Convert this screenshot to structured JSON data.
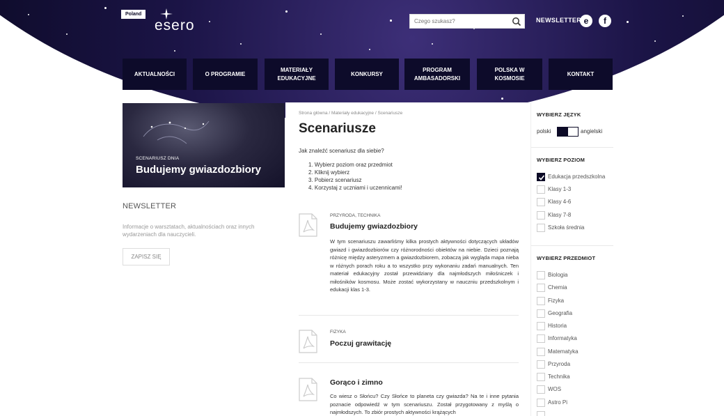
{
  "header": {
    "logo_country": "Poland",
    "logo_text": "esero",
    "search_placeholder": "Czego szukasz?",
    "newsletter_label": "NEWSLETTER",
    "e_label": "e",
    "fb_label": "f"
  },
  "nav": [
    "AKTUALNOŚCI",
    "O PROGRAMIE",
    "MATERIAŁY EDUKACYJNE",
    "KONKURSY",
    "PROGRAM AMBASADORSKI",
    "POLSKA W KOSMOSIE",
    "KONTAKT"
  ],
  "feature": {
    "label": "SCENARIUSZ DNIA",
    "title": "Budujemy gwiazdozbiory"
  },
  "newsletter": {
    "title": "NEWSLETTER",
    "text": "Informacje o warsztatach, aktualnościach oraz innych wydarzeniach dla nauczycieli.",
    "button": "ZAPISZ SIĘ"
  },
  "main": {
    "breadcrumb": "Strona główna  /  Materiały edukacyjne  /  Scenariusze",
    "title": "Scenariusze",
    "intro": "Jak znaleźć scenariusz dla siebie?",
    "steps": [
      "1. Wybierz poziom oraz przedmiot",
      "2. Kliknij wybierz",
      "3. Pobierz scenariusz",
      "4. Korzystaj z uczniami i uczennicami!"
    ],
    "entries": [
      {
        "category": "PRZYRODA, TECHNIKA",
        "title": "Budujemy gwiazdozbiory",
        "desc": "W tym scenariuszu zawarliśmy kilka prostych aktywności dotyczących układów gwiazd i gwiazdozbiorów czy różnorodności obiektów na niebie. Dzieci poznają różnicę między asteryzmem a gwiazdozbiorem, zobaczą jak wygląda mapa nieba w różnych porach roku a to wszystko przy wykonaniu zadań manualnych. Ten materiał edukacyjny został przewidziany dla najmłodszych miłośniczek i miłośników kosmosu. Może zostać wykorzystany w nauczniu przedszkolnym i edukacji klas 1-3."
      },
      {
        "category": "FIZYKA",
        "title": "Poczuj grawitację",
        "desc": ""
      },
      {
        "category": "",
        "title": "Gorąco i zimno",
        "desc": "Co wiesz o Słońcu? Czy Słońce to planeta czy gwiazda? Na te i inne pytania poznacie odpowiedź w tym scenariuszu. Został przygotowany z myślą o najmłodszych. To zbiór prostych aktywności krążących"
      }
    ]
  },
  "sidebar": {
    "language": {
      "heading": "WYBIERZ JĘZYK",
      "left": "polski",
      "right": "angielski",
      "selected": "polski"
    },
    "level": {
      "heading": "WYBIERZ POZIOM",
      "items": [
        {
          "label": "Edukacja przedszkolna",
          "checked": true
        },
        {
          "label": "Klasy 1-3",
          "checked": false
        },
        {
          "label": "Klasy 4-6",
          "checked": false
        },
        {
          "label": "Klasy 7-8",
          "checked": false
        },
        {
          "label": "Szkoła średnia",
          "checked": false
        }
      ]
    },
    "subject": {
      "heading": "WYBIERZ PRZEDMIOT",
      "items": [
        "Biologia",
        "Chemia",
        "Fizyka",
        "Geografia",
        "Historia",
        "Informatyka",
        "Matematyka",
        "Przyroda",
        "Technika",
        "WOS",
        "Astro Pi"
      ]
    }
  },
  "colors": {
    "navy": "#0c0a26",
    "nav_bg": "#0d0b2a",
    "accent": "#ffffff"
  }
}
